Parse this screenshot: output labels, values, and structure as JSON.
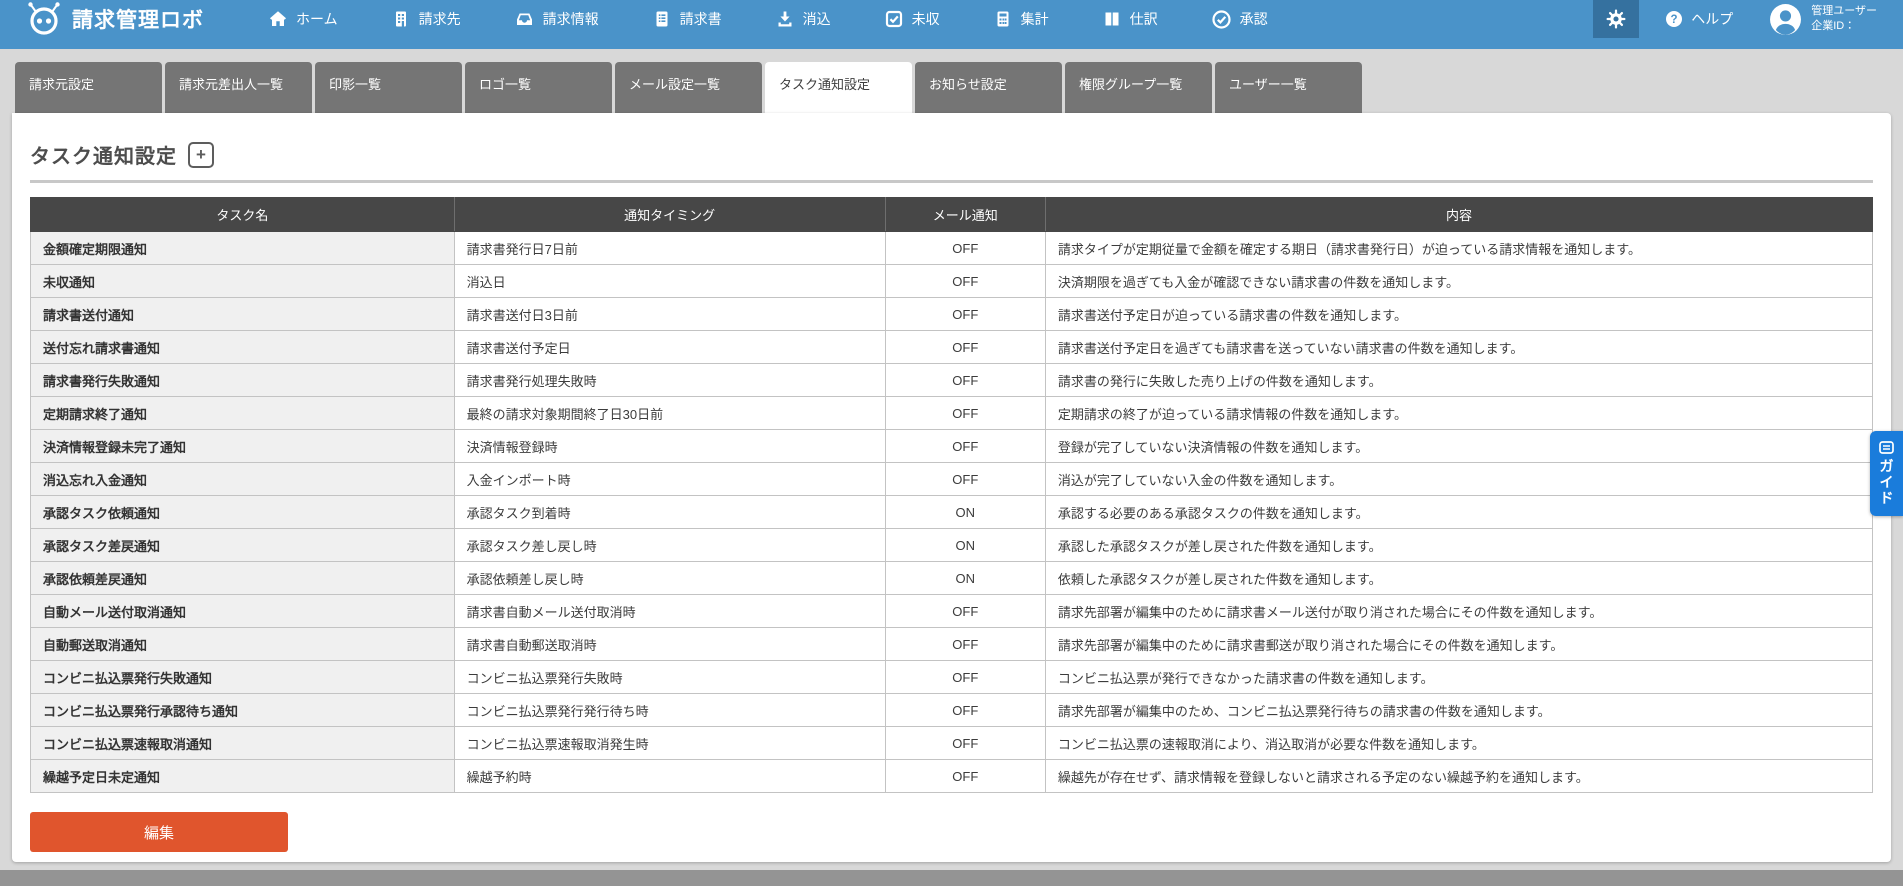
{
  "header": {
    "logo_text": "請求管理ロボ",
    "nav_items": [
      {
        "id": "home",
        "label": "ホーム",
        "icon": "home-icon"
      },
      {
        "id": "billing-dest",
        "label": "請求先",
        "icon": "building-icon"
      },
      {
        "id": "billing-info",
        "label": "請求情報",
        "icon": "tray-icon"
      },
      {
        "id": "invoice",
        "label": "請求書",
        "icon": "document-icon"
      },
      {
        "id": "clearing",
        "label": "消込",
        "icon": "download-icon"
      },
      {
        "id": "unreceived",
        "label": "未収",
        "icon": "checkbox-icon"
      },
      {
        "id": "aggregate",
        "label": "集計",
        "icon": "calculator-icon"
      },
      {
        "id": "journal",
        "label": "仕訳",
        "icon": "columns-icon"
      },
      {
        "id": "approval",
        "label": "承認",
        "icon": "check-circle-icon"
      }
    ],
    "help_label": "ヘルプ",
    "user_line1": "管理ユーザー",
    "user_line2": "企業ID："
  },
  "tabs": [
    {
      "id": "billing-source-settings",
      "label": "請求元設定"
    },
    {
      "id": "billing-source-senders",
      "label": "請求元差出人一覧"
    },
    {
      "id": "seal-list",
      "label": "印影一覧"
    },
    {
      "id": "logo-list",
      "label": "ロゴ一覧"
    },
    {
      "id": "mail-settings-list",
      "label": "メール設定一覧"
    },
    {
      "id": "task-notification-settings",
      "label": "タスク通知設定"
    },
    {
      "id": "announcement-settings",
      "label": "お知らせ設定"
    },
    {
      "id": "permission-group-list",
      "label": "権限グループ一覧"
    },
    {
      "id": "user-list",
      "label": "ユーザー一覧"
    }
  ],
  "active_tab_index": 5,
  "page": {
    "title": "タスク通知設定",
    "add_button_label": "+"
  },
  "table": {
    "columns": [
      "タスク名",
      "通知タイミング",
      "メール通知",
      "内容"
    ],
    "rows": [
      {
        "name": "金額確定期限通知",
        "timing": "請求書発行日7日前",
        "mail": "OFF",
        "description": "請求タイプが定期従量で金額を確定する期日（請求書発行日）が迫っている請求情報を通知します。"
      },
      {
        "name": "未収通知",
        "timing": "消込日",
        "mail": "OFF",
        "description": "決済期限を過ぎても入金が確認できない請求書の件数を通知します。"
      },
      {
        "name": "請求書送付通知",
        "timing": "請求書送付日3日前",
        "mail": "OFF",
        "description": "請求書送付予定日が迫っている請求書の件数を通知します。"
      },
      {
        "name": "送付忘れ請求書通知",
        "timing": "請求書送付予定日",
        "mail": "OFF",
        "description": "請求書送付予定日を過ぎても請求書を送っていない請求書の件数を通知します。"
      },
      {
        "name": "請求書発行失敗通知",
        "timing": "請求書発行処理失敗時",
        "mail": "OFF",
        "description": "請求書の発行に失敗した売り上げの件数を通知します。"
      },
      {
        "name": "定期請求終了通知",
        "timing": "最終の請求対象期間終了日30日前",
        "mail": "OFF",
        "description": "定期請求の終了が迫っている請求情報の件数を通知します。"
      },
      {
        "name": "決済情報登録未完了通知",
        "timing": "決済情報登録時",
        "mail": "OFF",
        "description": "登録が完了していない決済情報の件数を通知します。"
      },
      {
        "name": "消込忘れ入金通知",
        "timing": "入金インポート時",
        "mail": "OFF",
        "description": "消込が完了していない入金の件数を通知します。"
      },
      {
        "name": "承認タスク依頼通知",
        "timing": "承認タスク到着時",
        "mail": "ON",
        "description": "承認する必要のある承認タスクの件数を通知します。"
      },
      {
        "name": "承認タスク差戻通知",
        "timing": "承認タスク差し戻し時",
        "mail": "ON",
        "description": "承認した承認タスクが差し戻された件数を通知します。"
      },
      {
        "name": "承認依頼差戻通知",
        "timing": "承認依頼差し戻し時",
        "mail": "ON",
        "description": "依頼した承認タスクが差し戻された件数を通知します。"
      },
      {
        "name": "自動メール送付取消通知",
        "timing": "請求書自動メール送付取消時",
        "mail": "OFF",
        "description": "請求先部署が編集中のために請求書メール送付が取り消された場合にその件数を通知します。"
      },
      {
        "name": "自動郵送取消通知",
        "timing": "請求書自動郵送取消時",
        "mail": "OFF",
        "description": "請求先部署が編集中のために請求書郵送が取り消された場合にその件数を通知します。"
      },
      {
        "name": "コンビニ払込票発行失敗通知",
        "timing": "コンビニ払込票発行失敗時",
        "mail": "OFF",
        "description": "コンビニ払込票が発行できなかった請求書の件数を通知します。"
      },
      {
        "name": "コンビニ払込票発行承認待ち通知",
        "timing": "コンビニ払込票発行発行待ち時",
        "mail": "OFF",
        "description": "請求先部署が編集中のため、コンビニ払込票発行待ちの請求書の件数を通知します。"
      },
      {
        "name": "コンビニ払込票速報取消通知",
        "timing": "コンビニ払込票速報取消発生時",
        "mail": "OFF",
        "description": "コンビニ払込票の速報取消により、消込取消が必要な件数を通知します。"
      },
      {
        "name": "繰越予定日未定通知",
        "timing": "繰越予約時",
        "mail": "OFF",
        "description": "繰越先が存在せず、請求情報を登録しないと請求される予定のない繰越予約を通知します。"
      }
    ]
  },
  "edit_button_label": "編集",
  "guide_tab_label": "ガイド",
  "colors": {
    "header_blue": "#4a93c9",
    "gear_active_blue": "#35719f",
    "tab_gray": "#757575",
    "table_header_gray": "#474747",
    "edit_button_orange": "#e0552d",
    "guide_blue": "#1a7cdb"
  }
}
